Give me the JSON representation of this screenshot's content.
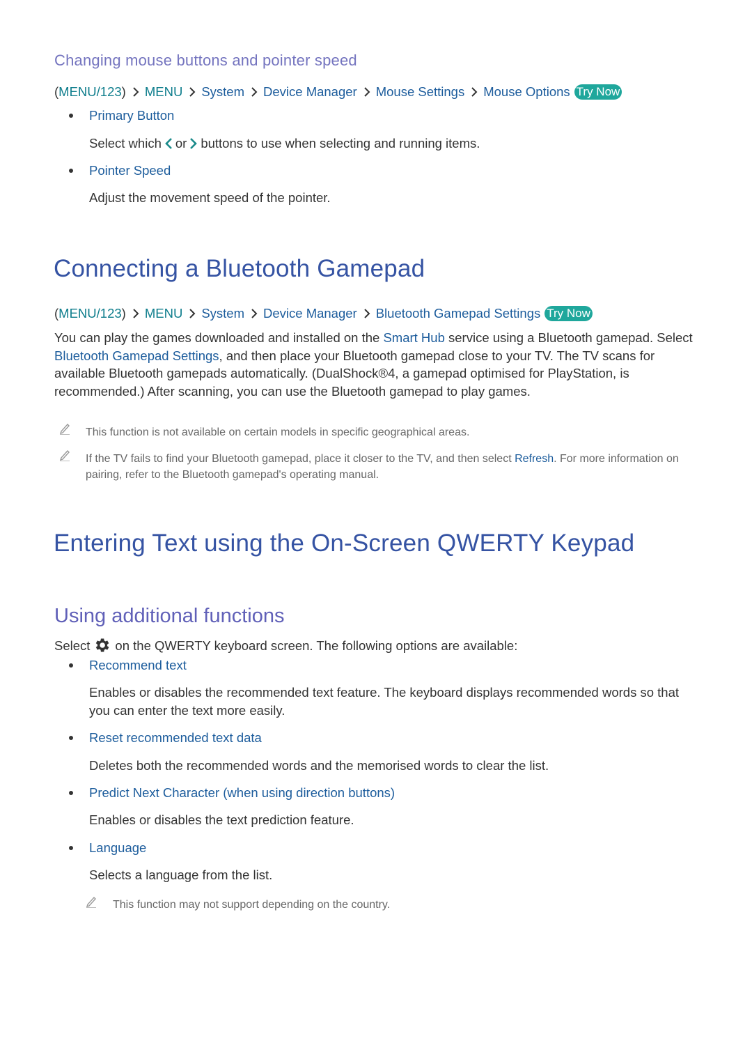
{
  "section1": {
    "heading": "Changing mouse buttons and pointer speed",
    "path": {
      "root": "MENU/123",
      "items": [
        "MENU",
        "System",
        "Device Manager",
        "Mouse Settings",
        "Mouse Options"
      ],
      "try_now": "Try Now"
    },
    "items": [
      {
        "label": "Primary Button",
        "desc_before": "Select which",
        "desc_or": "or",
        "desc_after": "buttons to use when selecting and running items."
      },
      {
        "label": "Pointer Speed",
        "desc": "Adjust the movement speed of the pointer."
      }
    ]
  },
  "section2": {
    "title": "Connecting a Bluetooth Gamepad",
    "path": {
      "root": "MENU/123",
      "items": [
        "MENU",
        "System",
        "Device Manager",
        "Bluetooth Gamepad Settings"
      ],
      "try_now": "Try Now"
    },
    "paragraph": {
      "p1": "You can play the games downloaded and installed on the ",
      "link1": "Smart Hub",
      "p2": " service using a Bluetooth gamepad. Select ",
      "link2": "Bluetooth Gamepad Settings",
      "p3": ", and then place your Bluetooth gamepad close to your TV. The TV scans for available Bluetooth gamepads automatically. (DualShock®4, a gamepad optimised for PlayStation, is recommended.) After scanning, you can use the Bluetooth gamepad to play games."
    },
    "notes": [
      {
        "text": "This function is not available on certain models in specific geographical areas."
      },
      {
        "p1": "If the TV fails to find your Bluetooth gamepad, place it closer to the TV, and then select ",
        "link": "Refresh",
        "p2": ". For more information on pairing, refer to the Bluetooth gamepad's operating manual."
      }
    ]
  },
  "section3": {
    "title": "Entering Text using the On-Screen QWERTY Keypad",
    "subheading": "Using additional functions",
    "intro_before": "Select",
    "intro_after": "on the QWERTY keyboard screen. The following options are available:",
    "items": [
      {
        "label": "Recommend text",
        "desc": "Enables or disables the recommended text feature. The keyboard displays recommended words so that you can enter the text more easily."
      },
      {
        "label": "Reset recommended text data",
        "desc": "Deletes both the recommended words and the memorised words to clear the list."
      },
      {
        "label": "Predict Next Character (when using direction buttons)",
        "desc": "Enables or disables the text prediction feature."
      },
      {
        "label": "Language",
        "desc": "Selects a language from the list."
      }
    ],
    "note": "This function may not support depending on the country."
  },
  "icons": {
    "chevron": "chevron-right-icon",
    "pencil": "pencil-note-icon",
    "gear": "gear-icon"
  },
  "colors": {
    "heading": "#3553a3",
    "subheading": "#7474bf",
    "link": "#1c5c9c",
    "menu": "#0e7d8c",
    "try_now": "#1fa79c"
  }
}
